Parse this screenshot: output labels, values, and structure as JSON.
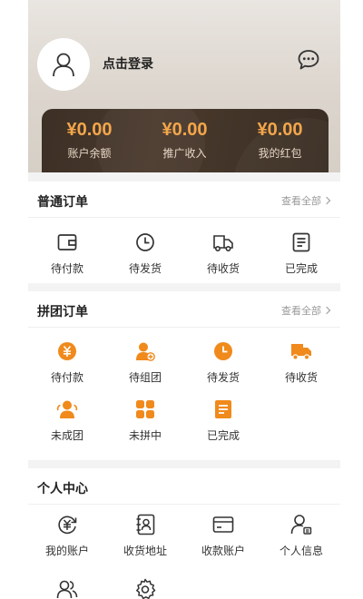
{
  "profile": {
    "login_text": "点击登录"
  },
  "wallet": [
    {
      "amount": "¥0.00",
      "label": "账户余额"
    },
    {
      "amount": "¥0.00",
      "label": "推广收入"
    },
    {
      "amount": "¥0.00",
      "label": "我的红包"
    }
  ],
  "normal_orders": {
    "title": "普通订单",
    "more": "查看全部",
    "items": [
      {
        "label": "待付款",
        "icon": "wallet-icon"
      },
      {
        "label": "待发货",
        "icon": "clock-icon"
      },
      {
        "label": "待收货",
        "icon": "truck-icon"
      },
      {
        "label": "已完成",
        "icon": "list-icon"
      }
    ]
  },
  "group_orders": {
    "title": "拼团订单",
    "more": "查看全部",
    "items": [
      {
        "label": "待付款",
        "icon": "yen-coin-icon"
      },
      {
        "label": "待组团",
        "icon": "add-person-icon"
      },
      {
        "label": "待发货",
        "icon": "clock-icon"
      },
      {
        "label": "待收货",
        "icon": "truck-icon"
      },
      {
        "label": "未成团",
        "icon": "group-icon"
      },
      {
        "label": "未拼中",
        "icon": "grid-icon"
      },
      {
        "label": "已完成",
        "icon": "list-icon"
      }
    ]
  },
  "personal": {
    "title": "个人中心",
    "items": [
      {
        "label": "我的账户",
        "icon": "yen-refresh-icon"
      },
      {
        "label": "收货地址",
        "icon": "address-book-icon"
      },
      {
        "label": "收款账户",
        "icon": "card-icon"
      },
      {
        "label": "个人信息",
        "icon": "user-info-icon"
      },
      {
        "label": "",
        "icon": "users-icon"
      },
      {
        "label": "",
        "icon": "gear-icon"
      }
    ]
  },
  "colors": {
    "accent": "#f08a1c",
    "wallet_amount": "#f4a64a",
    "wallet_bg": "#3c2f25"
  }
}
